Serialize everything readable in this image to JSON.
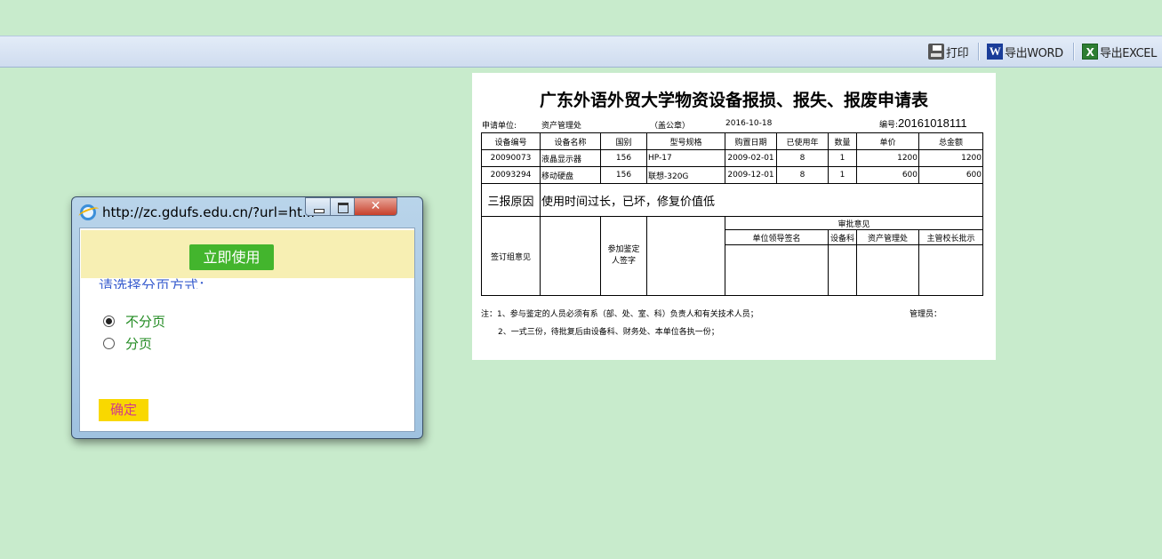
{
  "toolbar": {
    "print_label": "打印",
    "word_label": "导出WORD",
    "excel_label": "导出EXCEL",
    "word_icon_letter": "W",
    "excel_icon_letter": "X"
  },
  "form": {
    "title": "广东外语外贸大学物资设备报损、报失、报废申请表",
    "applicant_label": "申请单位:",
    "applicant_value": "资产管理处",
    "seal_label": "（盖公章）",
    "date": "2016-10-18",
    "number_label": "编号:",
    "number_value": "20161018111",
    "headers": [
      "设备编号",
      "设备名称",
      "国别",
      "型号规格",
      "购置日期",
      "已使用年",
      "数量",
      "单价",
      "总金额"
    ],
    "rows": [
      [
        "20090073",
        "液晶显示器",
        "156",
        "HP-17",
        "2009-02-01",
        "8",
        "1",
        "1200",
        "1200"
      ],
      [
        "20093294",
        "移动硬盘",
        "156",
        "联想-320G",
        "2009-12-01",
        "8",
        "1",
        "600",
        "600"
      ]
    ],
    "reason_label": "三报原因",
    "reason_value": "使用时间过长，已坏，修复价值低",
    "group_opinion_label": "签订组意见",
    "appraiser_sign_label_1": "参加鉴定",
    "appraiser_sign_label_2": "人签字",
    "approval_label": "审批意见",
    "approval_cols": [
      "单位领导签名",
      "设备科",
      "资产管理处",
      "主管校长批示"
    ],
    "note1": "注：1、参与鉴定的人员必须有系（部、处、室、科）负责人和有关技术人员；",
    "note1_right": "管理员：",
    "note2": "2、一式三份，待批复后由设备科、财务处、本单位各执一份；"
  },
  "dialog": {
    "title": "http://zc.gdufs.edu.cn/?url=ht...",
    "use_now_label": "立即使用",
    "prompt": "请选择分页方式：",
    "options": [
      {
        "label": "不分页",
        "checked": true
      },
      {
        "label": "分页",
        "checked": false
      }
    ],
    "confirm_label": "确定"
  }
}
